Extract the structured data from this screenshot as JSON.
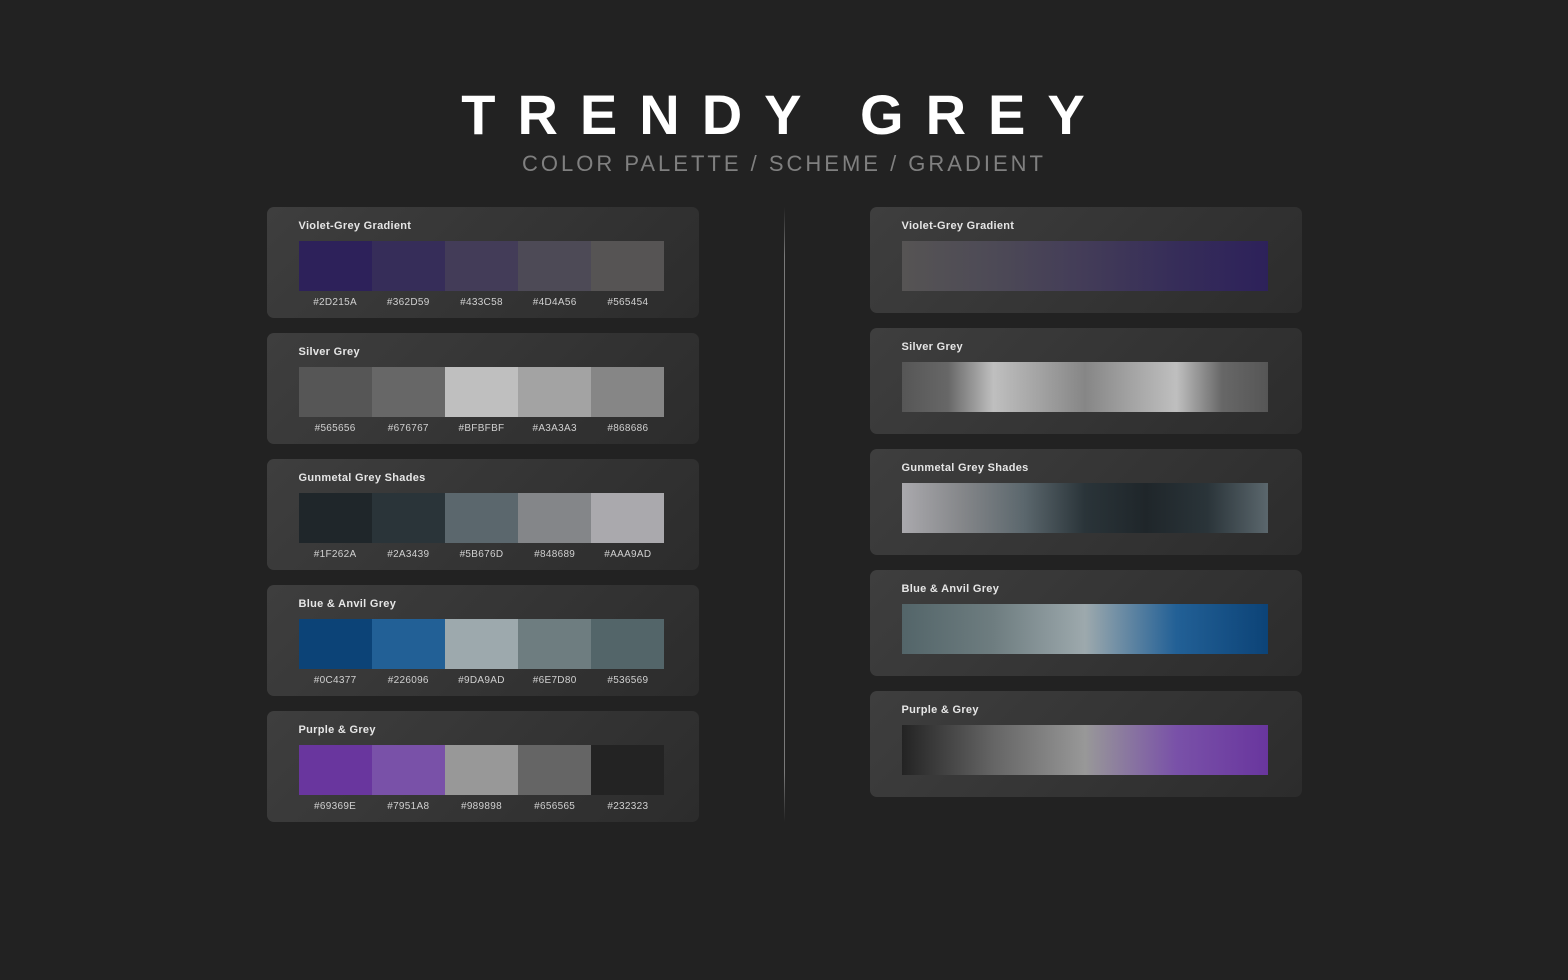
{
  "header": {
    "title": "TRENDY GREY",
    "subtitle": "COLOR PALETTE / SCHEME / GRADIENT"
  },
  "palettes": [
    {
      "name": "Violet-Grey Gradient",
      "colors": [
        "#2D215A",
        "#362D59",
        "#433C58",
        "#4D4A56",
        "#565454"
      ],
      "gradient_stops": [
        "#565454",
        "#4D4A56",
        "#433C58",
        "#362D59",
        "#2D215A"
      ]
    },
    {
      "name": "Silver Grey",
      "colors": [
        "#565656",
        "#676767",
        "#BFBFBF",
        "#A3A3A3",
        "#868686"
      ],
      "gradient_stops": [
        "#565656",
        "#676767",
        "#BFBFBF",
        "#A3A3A3",
        "#868686",
        "#A3A3A3",
        "#BFBFBF",
        "#676767",
        "#565656"
      ]
    },
    {
      "name": "Gunmetal Grey Shades",
      "colors": [
        "#1F262A",
        "#2A3439",
        "#5B676D",
        "#848689",
        "#AAA9AD"
      ],
      "gradient_stops": [
        "#AAA9AD",
        "#848689",
        "#5B676D",
        "#2A3439",
        "#1F262A",
        "#2A3439",
        "#5B676D"
      ]
    },
    {
      "name": "Blue & Anvil Grey",
      "colors": [
        "#0C4377",
        "#226096",
        "#9DA9AD",
        "#6E7D80",
        "#536569"
      ],
      "gradient_stops": [
        "#536569",
        "#6E7D80",
        "#9DA9AD",
        "#226096",
        "#0C4377"
      ]
    },
    {
      "name": "Purple & Grey",
      "colors": [
        "#69369E",
        "#7951A8",
        "#989898",
        "#656565",
        "#232323"
      ],
      "gradient_stops": [
        "#232323",
        "#656565",
        "#989898",
        "#7951A8",
        "#69369E"
      ]
    }
  ]
}
